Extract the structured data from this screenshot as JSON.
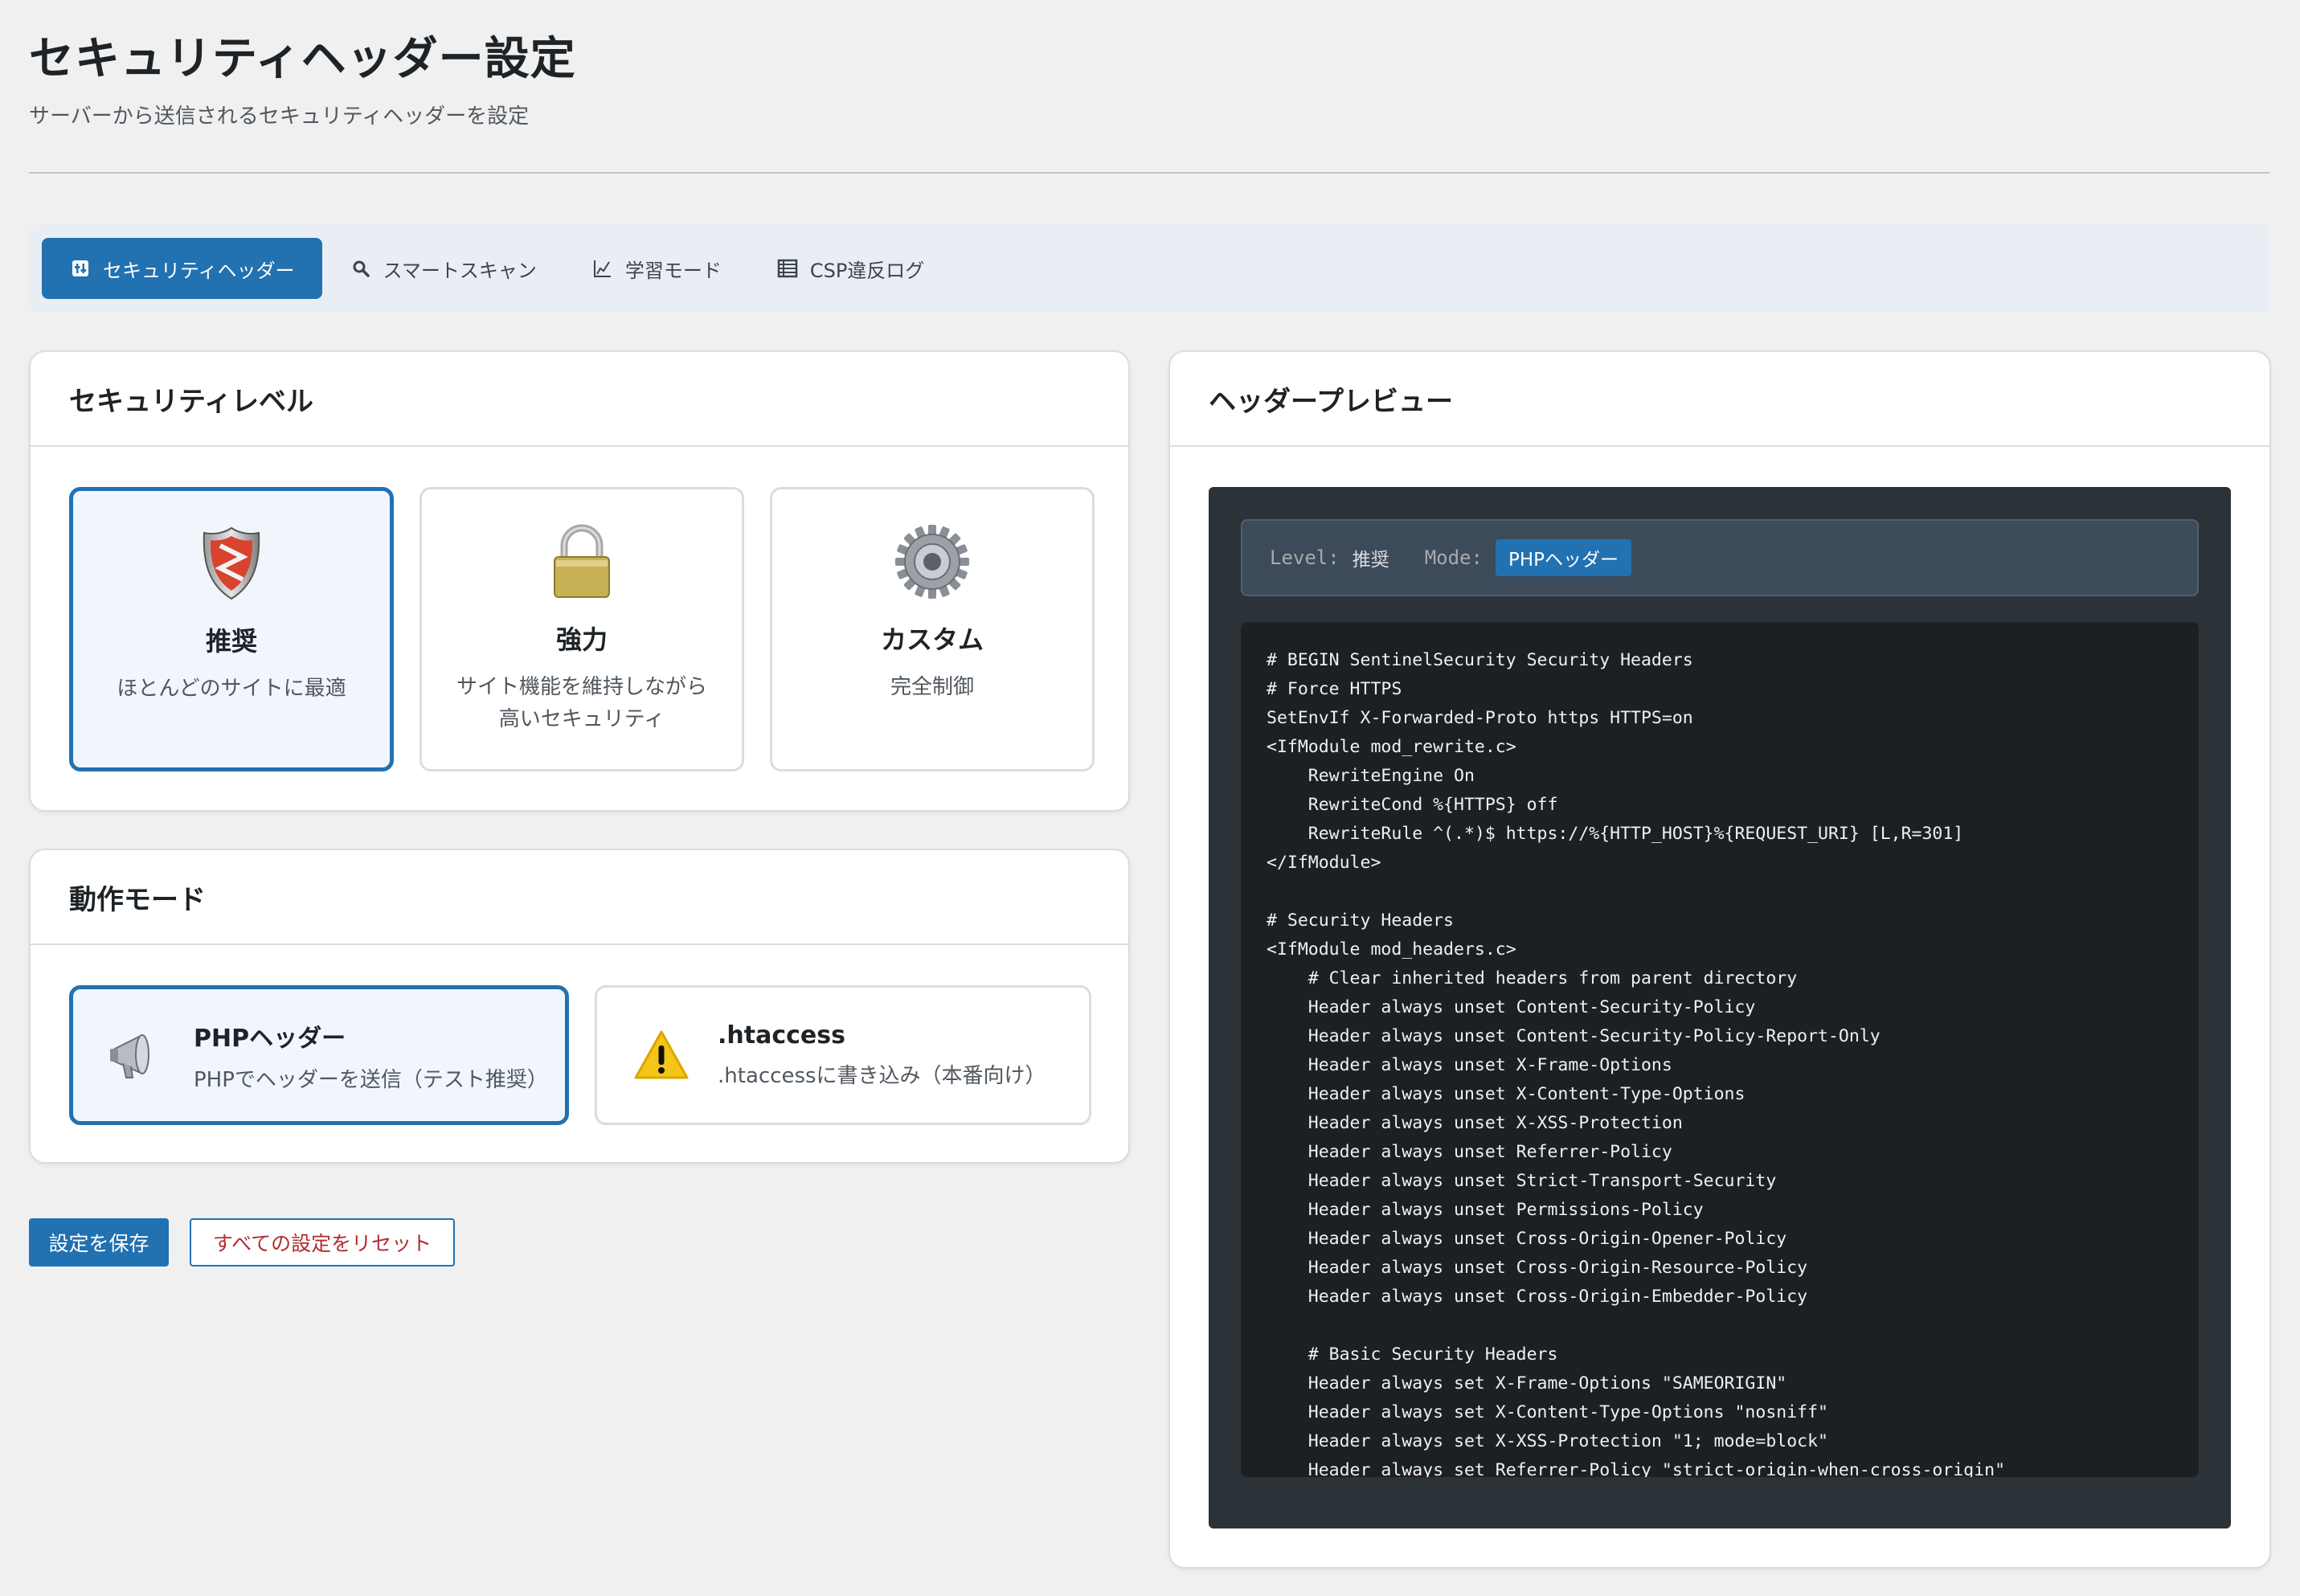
{
  "page": {
    "title": "セキュリティヘッダー設定",
    "subtitle": "サーバーから送信されるセキュリティヘッダーを設定"
  },
  "tabs": [
    {
      "label": "セキュリティヘッダー",
      "icon": "sliders-icon",
      "active": true
    },
    {
      "label": "スマートスキャン",
      "icon": "search-icon",
      "active": false
    },
    {
      "label": "学習モード",
      "icon": "chart-line-icon",
      "active": false
    },
    {
      "label": "CSP違反ログ",
      "icon": "list-icon",
      "active": false
    }
  ],
  "security_level": {
    "title": "セキュリティレベル",
    "options": [
      {
        "name": "推奨",
        "desc": "ほとんどのサイトに最適",
        "icon": "shield-icon",
        "selected": true
      },
      {
        "name": "強力",
        "desc": "サイト機能を維持しながら高いセキュリティ",
        "icon": "padlock-icon",
        "selected": false
      },
      {
        "name": "カスタム",
        "desc": "完全制御",
        "icon": "gear-icon",
        "selected": false
      }
    ]
  },
  "mode": {
    "title": "動作モード",
    "options": [
      {
        "name": "PHPヘッダー",
        "desc": "PHPでヘッダーを送信（テスト推奨）",
        "icon": "megaphone-icon",
        "selected": true
      },
      {
        "name": ".htaccess",
        "desc": ".htaccessに書き込み（本番向け）",
        "icon": "warning-icon",
        "selected": false
      }
    ]
  },
  "buttons": {
    "save": "設定を保存",
    "reset": "すべての設定をリセット"
  },
  "preview": {
    "title": "ヘッダープレビュー",
    "level_label": "Level:",
    "level_value": "推奨",
    "mode_label": "Mode:",
    "mode_value": "PHPヘッダー",
    "code_lines": [
      "# BEGIN SentinelSecurity Security Headers",
      "# Force HTTPS",
      "SetEnvIf X-Forwarded-Proto https HTTPS=on",
      "<IfModule mod_rewrite.c>",
      "    RewriteEngine On",
      "    RewriteCond %{HTTPS} off",
      "    RewriteRule ^(.*)$ https://%{HTTP_HOST}%{REQUEST_URI} [L,R=301]",
      "</IfModule>",
      "",
      "# Security Headers",
      "<IfModule mod_headers.c>",
      "    # Clear inherited headers from parent directory",
      "    Header always unset Content-Security-Policy",
      "    Header always unset Content-Security-Policy-Report-Only",
      "    Header always unset X-Frame-Options",
      "    Header always unset X-Content-Type-Options",
      "    Header always unset X-XSS-Protection",
      "    Header always unset Referrer-Policy",
      "    Header always unset Strict-Transport-Security",
      "    Header always unset Permissions-Policy",
      "    Header always unset Cross-Origin-Opener-Policy",
      "    Header always unset Cross-Origin-Resource-Policy",
      "    Header always unset Cross-Origin-Embedder-Policy",
      "",
      "    # Basic Security Headers",
      "    Header always set X-Frame-Options \"SAMEORIGIN\"",
      "    Header always set X-Content-Type-Options \"nosniff\"",
      "    Header always set X-XSS-Protection \"1; mode=block\"",
      "    Header always set Referrer-Policy \"strict-origin-when-cross-origin\""
    ]
  },
  "colors": {
    "accent": "#2271b1",
    "danger": "#b32d2e",
    "code_bg": "#1d2023"
  }
}
